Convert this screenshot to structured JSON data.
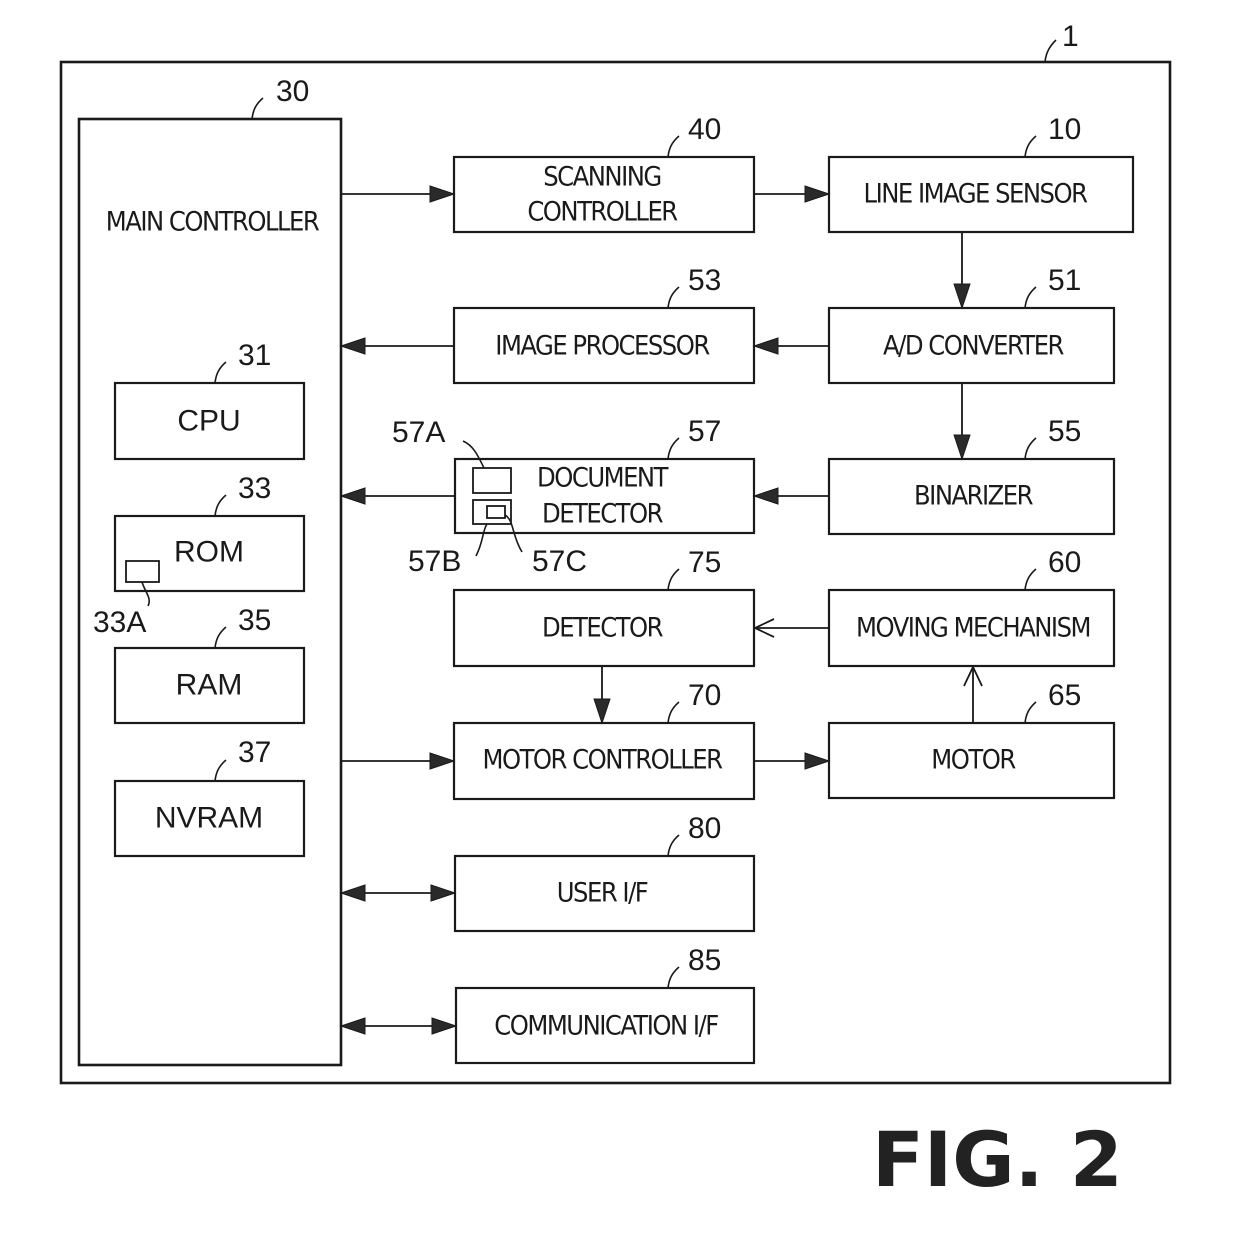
{
  "figure_label": "FIG. 2",
  "device": {
    "ref": "1"
  },
  "blocks": {
    "main_controller": {
      "label": "MAIN CONTROLLER",
      "ref": "30"
    },
    "cpu": {
      "label": "CPU",
      "ref": "31"
    },
    "rom": {
      "label": "ROM",
      "ref": "33",
      "sub_ref": "33A"
    },
    "ram": {
      "label": "RAM",
      "ref": "35"
    },
    "nvram": {
      "label": "NVRAM",
      "ref": "37"
    },
    "scanning_controller": {
      "label_line1": "SCANNING",
      "label_line2": "CONTROLLER",
      "ref": "40"
    },
    "line_image_sensor": {
      "label": "LINE IMAGE SENSOR",
      "ref": "10"
    },
    "image_processor": {
      "label": "IMAGE PROCESSOR",
      "ref": "53"
    },
    "ad_converter": {
      "label": "A/D CONVERTER",
      "ref": "51"
    },
    "document_detector": {
      "label_line1": "DOCUMENT",
      "label_line2": "DETECTOR",
      "ref": "57",
      "sub_refs": [
        "57A",
        "57B",
        "57C"
      ]
    },
    "binarizer": {
      "label": "BINARIZER",
      "ref": "55"
    },
    "detector": {
      "label": "DETECTOR",
      "ref": "75"
    },
    "moving_mechanism": {
      "label": "MOVING MECHANISM",
      "ref": "60"
    },
    "motor_controller": {
      "label": "MOTOR CONTROLLER",
      "ref": "70"
    },
    "motor": {
      "label": "MOTOR",
      "ref": "65"
    },
    "user_if": {
      "label": "USER I/F",
      "ref": "80"
    },
    "communication_if": {
      "label": "COMMUNICATION I/F",
      "ref": "85"
    }
  },
  "connections": [
    {
      "from": "main_controller",
      "to": "scanning_controller",
      "type": "arrow"
    },
    {
      "from": "scanning_controller",
      "to": "line_image_sensor",
      "type": "arrow"
    },
    {
      "from": "line_image_sensor",
      "to": "ad_converter",
      "type": "arrow"
    },
    {
      "from": "ad_converter",
      "to": "image_processor",
      "type": "arrow"
    },
    {
      "from": "image_processor",
      "to": "main_controller",
      "type": "arrow"
    },
    {
      "from": "ad_converter",
      "to": "binarizer",
      "type": "arrow"
    },
    {
      "from": "binarizer",
      "to": "document_detector",
      "type": "arrow"
    },
    {
      "from": "document_detector",
      "to": "main_controller",
      "type": "arrow"
    },
    {
      "from": "moving_mechanism",
      "to": "detector",
      "type": "open-arrow"
    },
    {
      "from": "detector",
      "to": "motor_controller",
      "type": "arrow"
    },
    {
      "from": "main_controller",
      "to": "motor_controller",
      "type": "arrow"
    },
    {
      "from": "motor_controller",
      "to": "motor",
      "type": "arrow"
    },
    {
      "from": "motor",
      "to": "moving_mechanism",
      "type": "open-arrow"
    },
    {
      "from": "main_controller",
      "to": "user_if",
      "type": "bidirectional"
    },
    {
      "from": "main_controller",
      "to": "communication_if",
      "type": "bidirectional"
    }
  ]
}
